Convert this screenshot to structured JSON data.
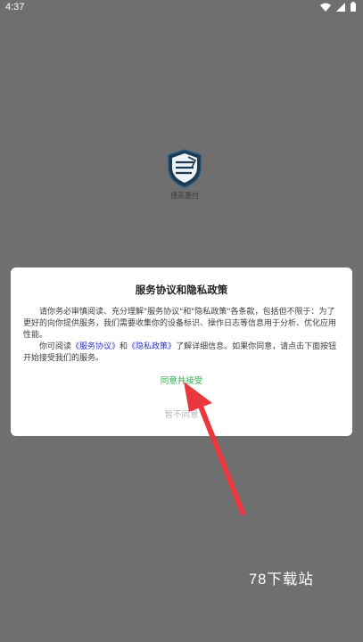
{
  "status_bar": {
    "time": "4:37",
    "icons": [
      "wifi-icon",
      "signal-icon",
      "battery-icon"
    ]
  },
  "splash": {
    "logo_icon": "shield-logo-icon",
    "app_name": "侵恶惠付"
  },
  "dialog": {
    "title": "服务协议和隐私政策",
    "para1": "请你务必审慎阅读、充分理解\"服务协议\"和\"隐私政策\"各条款，包括但不限于：为了更好的向你提供服务，我们需要收集你的设备标识、操作日志等信息用于分析、优化应用性能。",
    "para2_prefix": "你可阅读",
    "service_link": "《服务协议》",
    "para2_and": "和",
    "privacy_link": "《隐私政策》",
    "para2_suffix": "了解详细信息。如果你同意，请点击下面按钮开始接受我们的服务。",
    "agree_label": "同意并接受",
    "disagree_label": "暂不同意"
  },
  "watermark": "78下载站",
  "colors": {
    "overlay": "#6f6f6f",
    "agree": "#2bb14a",
    "link": "#2b35c8",
    "arrow": "#e8383d"
  }
}
